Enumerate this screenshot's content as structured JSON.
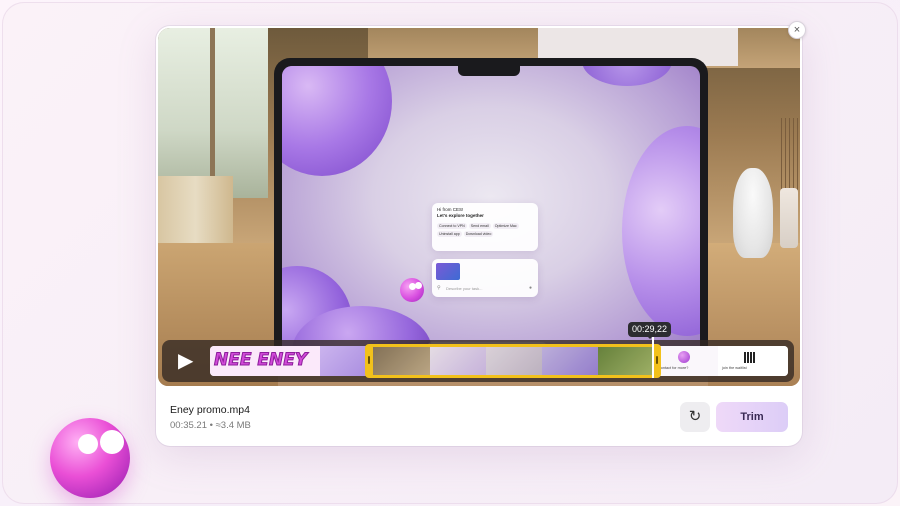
{
  "dialog": {
    "close_label": "×",
    "file": {
      "name": "Eney promo.mp4",
      "meta": "00:35.21 • ≈3.4 MB"
    },
    "timeline": {
      "playhead_time": "00:29,22",
      "play_label": "▶"
    },
    "actions": {
      "reset_label": "↻",
      "trim_label": "Trim"
    }
  },
  "screen": {
    "chat_greeting": "Hi from CES!",
    "chat_subtitle": "Let's explore together",
    "chips": [
      "Connect to VPN",
      "Send email",
      "Optimize Mac",
      "Uninstall app",
      "Download video"
    ],
    "task_placeholder": "Describe your task..."
  },
  "filmstrip": {
    "title_frame_text": "NEE ENEY",
    "frame_labels": [
      "Contact for more?",
      "join the waitlist"
    ]
  },
  "colors": {
    "accent_yellow": "#f2c11b",
    "mascot_pink": "#ea4fd6",
    "trim_button": "#e6d3f8"
  }
}
